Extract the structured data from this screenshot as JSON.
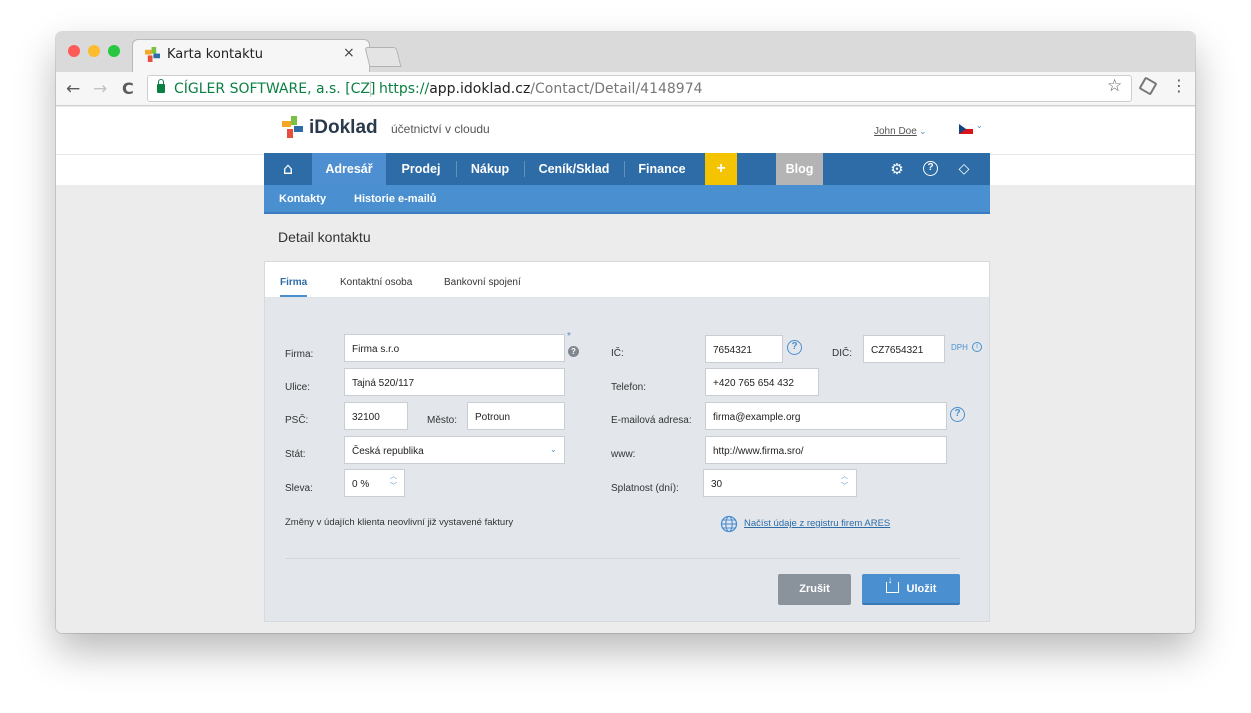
{
  "browser": {
    "tab_title": "Karta kontaktu",
    "tab_close": "×",
    "cert_label": "CÍGLER SOFTWARE, a.s. [CZ]",
    "url_scheme": "https://",
    "url_host": "app.idoklad.cz",
    "url_path": "/Contact/Detail/4148974",
    "back_icon": "←",
    "forward_icon": "→",
    "reload_icon": "C",
    "star_icon": "☆",
    "menu_icon": "⋮",
    "traffic_lights": {
      "close": "#fc5b57",
      "minimize": "#fdbb2f",
      "maximize": "#27c840"
    }
  },
  "header": {
    "logo_text": "iDoklad",
    "tagline": "účetnictví v cloudu",
    "user_name": "John Doe",
    "user_chevron": "⌄",
    "flag_chevron": "⌄"
  },
  "nav": {
    "home_icon": "⌂",
    "items": [
      "Adresář",
      "Prodej",
      "Nákup",
      "Ceník/Sklad",
      "Finance"
    ],
    "plus_label": "+",
    "blog_label": "Blog",
    "gear_icon": "⚙",
    "help_icon": "?",
    "notify_icon": "◇",
    "colors": {
      "bar": "#2d6ca7",
      "active": "#4d8fd0",
      "plus": "#f5c400",
      "blog": "#b4b4b4"
    }
  },
  "subnav": {
    "items": [
      "Kontakty",
      "Historie e-mailů"
    ]
  },
  "page": {
    "title": "Detail kontaktu"
  },
  "form": {
    "tabs": [
      "Firma",
      "Kontaktní osoba",
      "Bankovní spojení"
    ],
    "labels": {
      "firma": "Firma:",
      "ulice": "Ulice:",
      "psc": "PSČ:",
      "mesto": "Město:",
      "stat": "Stát:",
      "sleva": "Sleva:",
      "ic": "IČ:",
      "dic": "DIČ:",
      "telefon": "Telefon:",
      "email": "E-mailová adresa:",
      "www": "www:",
      "splatnost": "Splatnost (dní):"
    },
    "values": {
      "firma": "Firma s.r.o",
      "ulice": "Tajná 520/117",
      "psc": "32100",
      "mesto": "Potroun",
      "stat": "Česká republika",
      "sleva": "0 %",
      "ic": "7654321",
      "dic": "CZ7654321",
      "telefon": "+420 765 654 432",
      "email": "firma@example.org",
      "www": "http://www.firma.sro/",
      "splatnost": "30"
    },
    "required_mark": "*",
    "dph_label": "DPH",
    "info_icon": "i",
    "help_icon": "?",
    "note": "Změny v údajích klienta neovlivní již vystavené faktury",
    "ares_link": "Načíst údaje z registru firem ARES",
    "cancel_label": "Zrušit",
    "save_label": "Uložit"
  }
}
